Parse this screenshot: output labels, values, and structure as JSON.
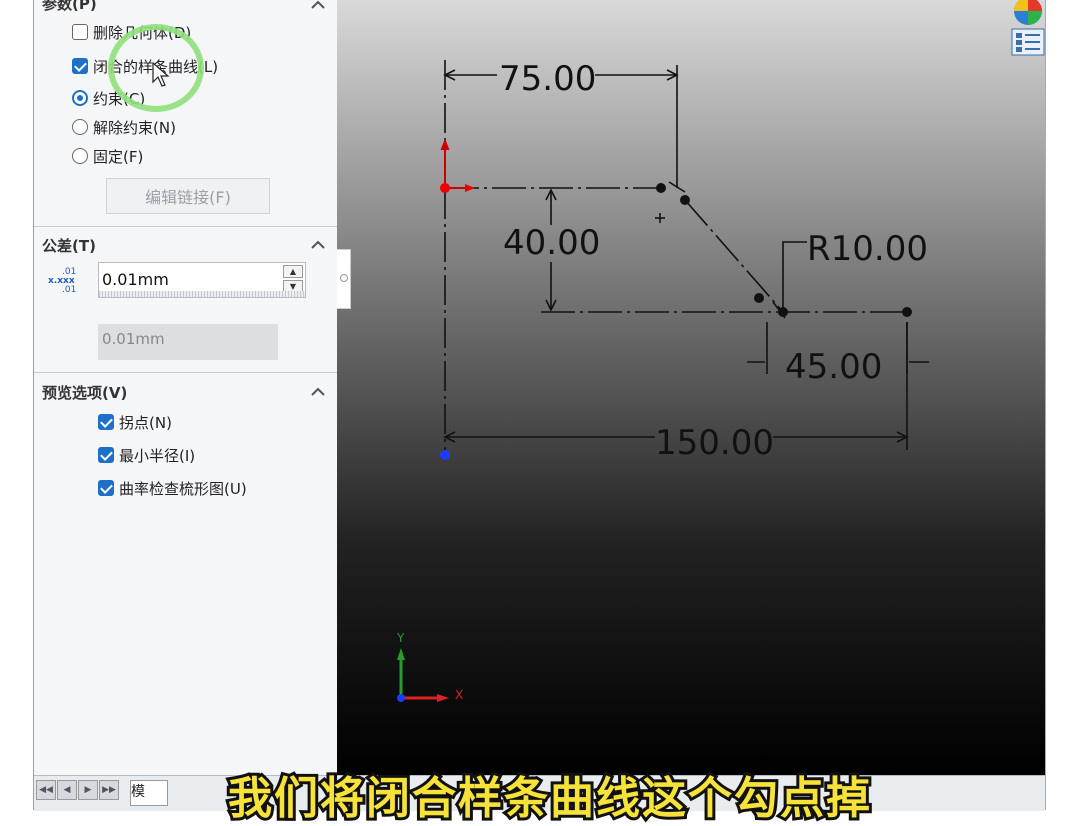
{
  "params_section": {
    "title": "参数(P)",
    "options": [
      {
        "kind": "checkbox",
        "label": "删除几何体(D)",
        "checked": false
      },
      {
        "kind": "checkbox",
        "label": "闭合的样条曲线(L)",
        "checked": true
      },
      {
        "kind": "radio",
        "label": "约束(C)",
        "checked": true
      },
      {
        "kind": "radio",
        "label": "解除约束(N)",
        "checked": false
      },
      {
        "kind": "radio",
        "label": "固定(F)",
        "checked": false
      }
    ],
    "edit_button": "编辑链接(F)"
  },
  "tolerance_section": {
    "title": "公差(T)",
    "icon_top": ".01",
    "icon_mid": "x.xxx",
    "icon_bot": ".01",
    "input_value": "0.01mm",
    "readonly_value": "0.01mm"
  },
  "preview_section": {
    "title": "预览选项(V)",
    "options": [
      {
        "label": "拐点(N)",
        "checked": true
      },
      {
        "label": "最小半径(I)",
        "checked": true
      },
      {
        "label": "曲率检查梳形图(U)",
        "checked": true
      }
    ]
  },
  "sketch": {
    "dims": {
      "top_width": "75.00",
      "height": "40.00",
      "radius": "R10.00",
      "right_width": "45.00",
      "total_width": "150.00"
    },
    "triad_x": "X",
    "triad_y": "Y"
  },
  "bottom_bar": {
    "nav": [
      "◀◀",
      "◀",
      "▶",
      "▶▶"
    ],
    "tab_label": "模"
  },
  "caption": "我们将闭合样条曲线这个勾点掉",
  "colors": {
    "accent": "#1e6fc8",
    "caption": "#f7e23a",
    "ring": "#8fe07a"
  }
}
